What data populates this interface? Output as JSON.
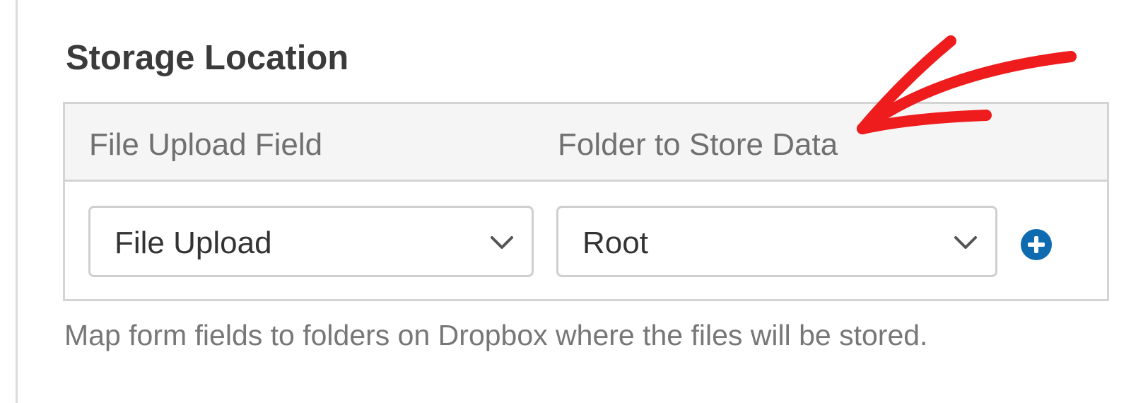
{
  "section": {
    "title": "Storage Location"
  },
  "table": {
    "columns": [
      {
        "label": "File Upload Field"
      },
      {
        "label": "Folder to Store Data"
      }
    ],
    "row": {
      "upload_field_value": "File Upload",
      "folder_value": "Root"
    }
  },
  "help_text": "Map form fields to folders on Dropbox where the files will be stored.",
  "icons": {
    "select_chevron": "chevron-down-icon",
    "add_row": "plus-circle-icon",
    "annotation": "red-arrow-icon"
  },
  "colors": {
    "accent": "#0e6bb0",
    "annotation": "#ee1c1c"
  }
}
